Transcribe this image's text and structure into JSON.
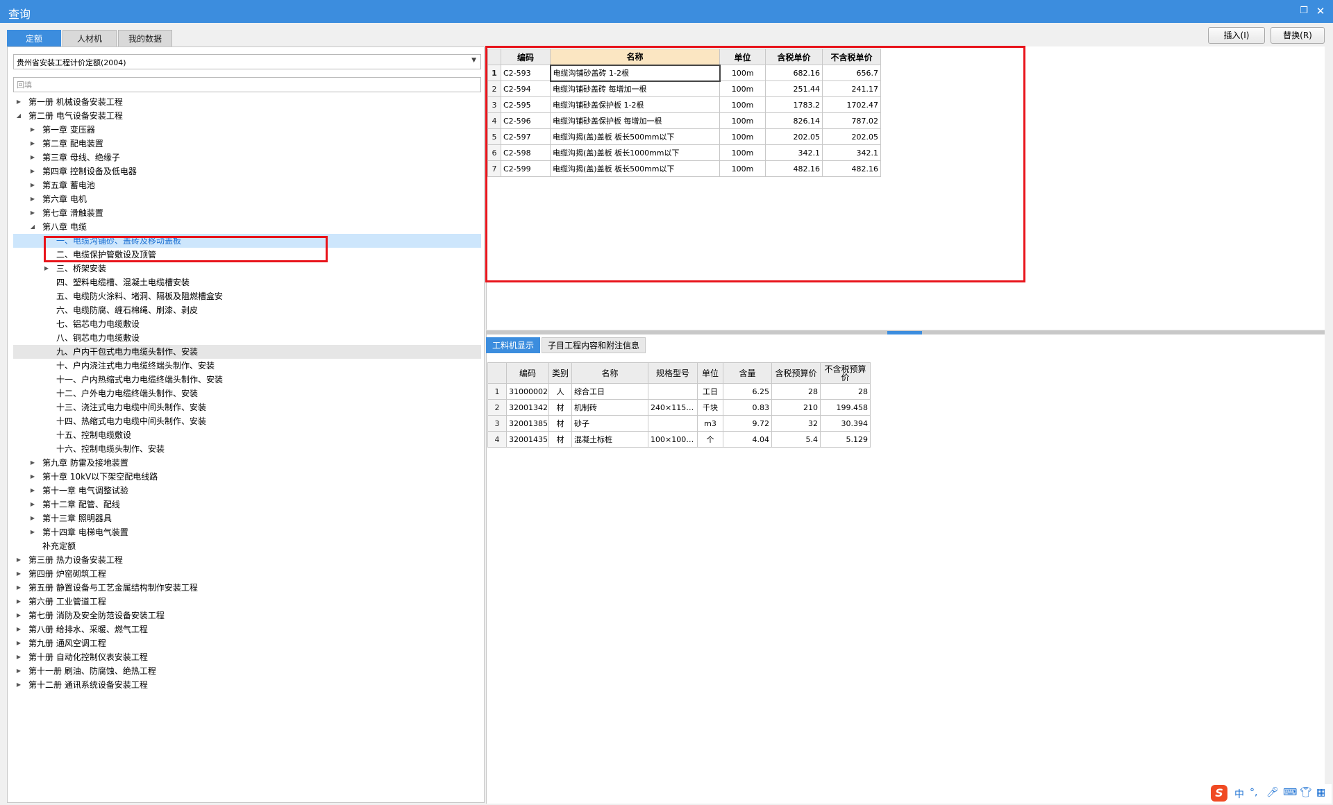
{
  "window": {
    "title": "查询"
  },
  "tabs": [
    "定额",
    "人材机",
    "我的数据"
  ],
  "buttons": {
    "insert": "插入(I)",
    "replace": "替换(R)"
  },
  "library": {
    "selected": "贵州省安装工程计价定额(2004)"
  },
  "search": {
    "value": "回填"
  },
  "tree": [
    {
      "label": "第一册 机械设备安装工程",
      "level": 0,
      "toggle": "collapsed"
    },
    {
      "label": "第二册 电气设备安装工程",
      "level": 0,
      "toggle": "expanded"
    },
    {
      "label": "第一章 变压器",
      "level": 1,
      "toggle": "collapsed"
    },
    {
      "label": "第二章 配电装置",
      "level": 1,
      "toggle": "collapsed"
    },
    {
      "label": "第三章 母线、绝缘子",
      "level": 1,
      "toggle": "collapsed"
    },
    {
      "label": "第四章 控制设备及低电器",
      "level": 1,
      "toggle": "collapsed"
    },
    {
      "label": "第五章 蓄电池",
      "level": 1,
      "toggle": "collapsed"
    },
    {
      "label": "第六章 电机",
      "level": 1,
      "toggle": "collapsed"
    },
    {
      "label": "第七章 滑触装置",
      "level": 1,
      "toggle": "collapsed"
    },
    {
      "label": "第八章 电缆",
      "level": 1,
      "toggle": "expanded"
    },
    {
      "label": "一、电缆沟铺砂、盖砖及移动盖板",
      "level": 2,
      "toggle": "none",
      "state": "selected"
    },
    {
      "label": "二、电缆保护管敷设及顶管",
      "level": 2,
      "toggle": "none"
    },
    {
      "label": "三、桥架安装",
      "level": 2,
      "toggle": "collapsed"
    },
    {
      "label": "四、塑料电缆槽、混凝土电缆槽安装",
      "level": 2,
      "toggle": "none"
    },
    {
      "label": "五、电缆防火涂料、堵洞、隔板及阻燃槽盒安",
      "level": 2,
      "toggle": "none"
    },
    {
      "label": "六、电缆防腐、缠石棉绳、刷漆、剥皮",
      "level": 2,
      "toggle": "none"
    },
    {
      "label": "七、铝芯电力电缆敷设",
      "level": 2,
      "toggle": "none"
    },
    {
      "label": "八、铜芯电力电缆敷设",
      "level": 2,
      "toggle": "none"
    },
    {
      "label": "九、户内干包式电力电缆头制作、安装",
      "level": 2,
      "toggle": "none",
      "state": "hover"
    },
    {
      "label": "十、户内浇注式电力电缆终端头制作、安装",
      "level": 2,
      "toggle": "none"
    },
    {
      "label": "十一、户内热缩式电力电缆终端头制作、安装",
      "level": 2,
      "toggle": "none"
    },
    {
      "label": "十二、户外电力电缆终端头制作、安装",
      "level": 2,
      "toggle": "none"
    },
    {
      "label": "十三、浇注式电力电缆中间头制作、安装",
      "level": 2,
      "toggle": "none"
    },
    {
      "label": "十四、热缩式电力电缆中间头制作、安装",
      "level": 2,
      "toggle": "none"
    },
    {
      "label": "十五、控制电缆敷设",
      "level": 2,
      "toggle": "none"
    },
    {
      "label": "十六、控制电缆头制作、安装",
      "level": 2,
      "toggle": "none"
    },
    {
      "label": "第九章 防雷及接地装置",
      "level": 1,
      "toggle": "collapsed"
    },
    {
      "label": "第十章 10kV以下架空配电线路",
      "level": 1,
      "toggle": "collapsed"
    },
    {
      "label": "第十一章 电气调整试验",
      "level": 1,
      "toggle": "collapsed"
    },
    {
      "label": "第十二章 配管、配线",
      "level": 1,
      "toggle": "collapsed"
    },
    {
      "label": "第十三章 照明器具",
      "level": 1,
      "toggle": "collapsed"
    },
    {
      "label": "第十四章 电梯电气装置",
      "level": 1,
      "toggle": "collapsed"
    },
    {
      "label": "补充定额",
      "level": 1,
      "toggle": "none"
    },
    {
      "label": "第三册 热力设备安装工程",
      "level": 0,
      "toggle": "collapsed"
    },
    {
      "label": "第四册 炉窑砌筑工程",
      "level": 0,
      "toggle": "collapsed"
    },
    {
      "label": "第五册 静置设备与工艺金属结构制作安装工程",
      "level": 0,
      "toggle": "collapsed"
    },
    {
      "label": "第六册 工业管道工程",
      "level": 0,
      "toggle": "collapsed"
    },
    {
      "label": "第七册 消防及安全防范设备安装工程",
      "level": 0,
      "toggle": "collapsed"
    },
    {
      "label": "第八册 给排水、采暖、燃气工程",
      "level": 0,
      "toggle": "collapsed"
    },
    {
      "label": "第九册 通风空调工程",
      "level": 0,
      "toggle": "collapsed"
    },
    {
      "label": "第十册 自动化控制仪表安装工程",
      "level": 0,
      "toggle": "collapsed"
    },
    {
      "label": "第十一册 刷油、防腐蚀、绝热工程",
      "level": 0,
      "toggle": "collapsed"
    },
    {
      "label": "第十二册 通讯系统设备安装工程",
      "level": 0,
      "toggle": "collapsed"
    }
  ],
  "quota_table": {
    "headers": [
      "编码",
      "名称",
      "单位",
      "含税单价",
      "不含税单价"
    ],
    "rows": [
      {
        "n": "1",
        "code": "C2-593",
        "name": "电缆沟铺砂盖砖 1-2根",
        "unit": "100m",
        "tax": "682.16",
        "notax": "656.7"
      },
      {
        "n": "2",
        "code": "C2-594",
        "name": "电缆沟铺砂盖砖 每增加一根",
        "unit": "100m",
        "tax": "251.44",
        "notax": "241.17"
      },
      {
        "n": "3",
        "code": "C2-595",
        "name": "电缆沟铺砂盖保护板 1-2根",
        "unit": "100m",
        "tax": "1783.2",
        "notax": "1702.47"
      },
      {
        "n": "4",
        "code": "C2-596",
        "name": "电缆沟铺砂盖保护板 每增加一根",
        "unit": "100m",
        "tax": "826.14",
        "notax": "787.02"
      },
      {
        "n": "5",
        "code": "C2-597",
        "name": "电缆沟揭(盖)盖板 板长500mm以下",
        "unit": "100m",
        "tax": "202.05",
        "notax": "202.05"
      },
      {
        "n": "6",
        "code": "C2-598",
        "name": "电缆沟揭(盖)盖板 板长1000mm以下",
        "unit": "100m",
        "tax": "342.1",
        "notax": "342.1"
      },
      {
        "n": "7",
        "code": "C2-599",
        "name": "电缆沟揭(盖)盖板 板长500mm以下",
        "unit": "100m",
        "tax": "482.16",
        "notax": "482.16"
      }
    ]
  },
  "sub_tabs": [
    "工料机显示",
    "子目工程内容和附注信息"
  ],
  "material_table": {
    "headers": [
      "编码",
      "类别",
      "名称",
      "规格型号",
      "单位",
      "含量",
      "含税预算价",
      "不含税预算价"
    ],
    "rows": [
      {
        "n": "1",
        "code": "31000002",
        "cat": "人",
        "name": "综合工日",
        "spec": "",
        "unit": "工日",
        "qty": "6.25",
        "tax": "28",
        "notax": "28"
      },
      {
        "n": "2",
        "code": "32001342",
        "cat": "材",
        "name": "机制砖",
        "spec": "240×115…",
        "unit": "千块",
        "qty": "0.83",
        "tax": "210",
        "notax": "199.458"
      },
      {
        "n": "3",
        "code": "32001385",
        "cat": "材",
        "name": "砂子",
        "spec": "",
        "unit": "m3",
        "qty": "9.72",
        "tax": "32",
        "notax": "30.394"
      },
      {
        "n": "4",
        "code": "32001435",
        "cat": "材",
        "name": "混凝土标桩",
        "spec": "100×100…",
        "unit": "个",
        "qty": "4.04",
        "tax": "5.4",
        "notax": "5.129"
      }
    ]
  },
  "ime": {
    "logo": "S",
    "mode": "中"
  },
  "colors": {
    "accent": "#3c8dde",
    "highlight": "#e8141b",
    "selected_bg": "#cde6fc"
  }
}
